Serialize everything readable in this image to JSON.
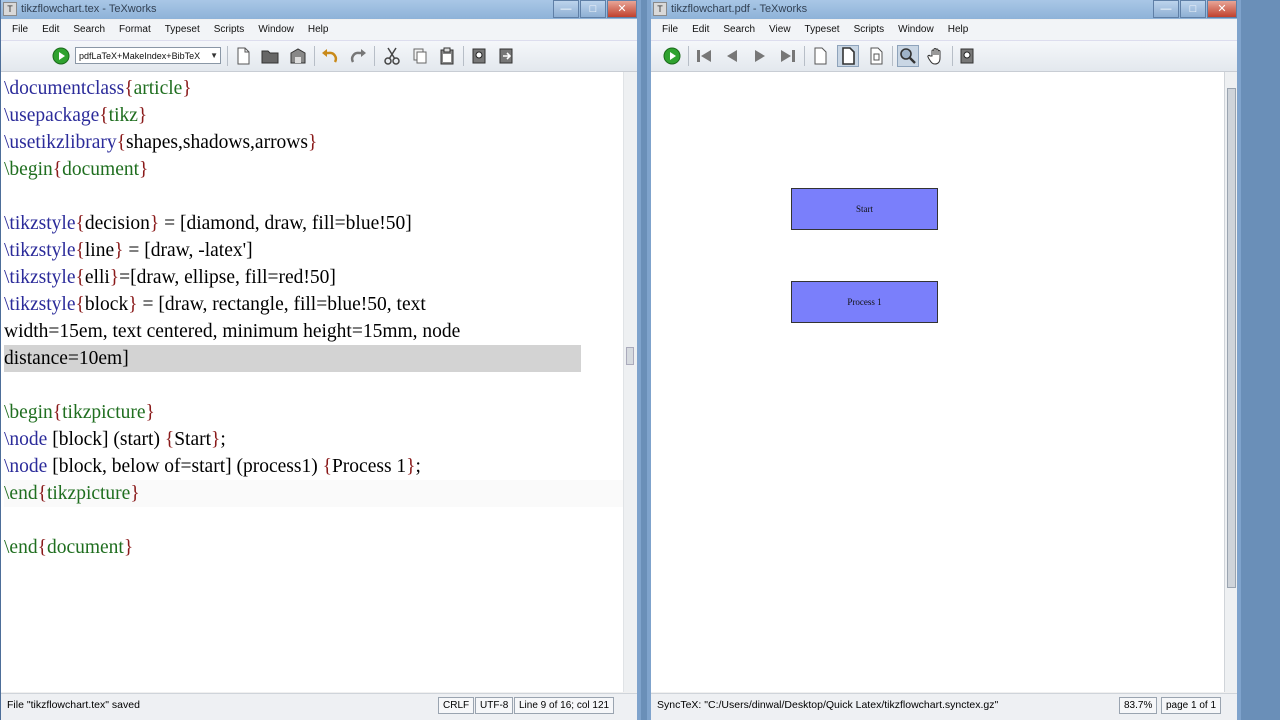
{
  "editor": {
    "title": "tikzflowchart.tex - TeXworks",
    "menu": [
      "File",
      "Edit",
      "Search",
      "Format",
      "Typeset",
      "Scripts",
      "Window",
      "Help"
    ],
    "typeset_engine": "pdfLaTeX+MakeIndex+BibTeX",
    "code": [
      {
        "cmd": "\\documentclass",
        "arg": "article"
      },
      {
        "cmd": "\\usepackage",
        "arg": "tikz"
      },
      {
        "cmd": "\\usetikzlibrary",
        "arg": "shapes,shadows,arrows"
      },
      {
        "cmd": "\\begin",
        "arg": "document"
      },
      {
        "cmd": "\\tikzstyle",
        "arg": "decision",
        "rest": " = [diamond, draw, fill=blue!50]"
      },
      {
        "cmd": "\\tikzstyle",
        "arg": "line",
        "rest": " = [draw, -latex']"
      },
      {
        "cmd": "\\tikzstyle",
        "arg": "elli",
        "rest": "=[draw, ellipse, fill=red!50]"
      },
      {
        "cmd": "\\tikzstyle",
        "arg": "block",
        "rest": " = [draw, rectangle, fill=blue!50, text"
      },
      {
        "plain": "width=15em, text centered, minimum height=15mm, node"
      },
      {
        "plain": "distance=10em]"
      },
      {
        "cmd": "\\begin",
        "arg": "tikzpicture"
      },
      {
        "cmd": "\\node",
        "rest": " [block] (start) ",
        "arg2": "Start",
        "tail": ";"
      },
      {
        "cmd": "\\node",
        "rest": " [block, below of=start] (process1) ",
        "arg2": "Process 1",
        "tail": ";"
      },
      {
        "cmd": "\\end",
        "arg": "tikzpicture"
      },
      {
        "cmd": "\\end",
        "arg": "document"
      }
    ],
    "status_message": "File \"tikzflowchart.tex\" saved",
    "line_ending": "CRLF",
    "encoding": "UTF-8",
    "cursor_position": "Line 9 of 16; col 121"
  },
  "viewer": {
    "title": "tikzflowchart.pdf - TeXworks",
    "menu": [
      "File",
      "Edit",
      "Search",
      "View",
      "Typeset",
      "Scripts",
      "Window",
      "Help"
    ],
    "nodes": [
      {
        "label": "Start"
      },
      {
        "label": "Process 1"
      }
    ],
    "node_fill_color": "#7a7ffb",
    "synctex_message": "SyncTeX: \"C:/Users/dinwal/Desktop/Quick Latex/tikzflowchart.synctex.gz\"",
    "zoom": "83.7%",
    "page_info": "page 1 of 1"
  }
}
